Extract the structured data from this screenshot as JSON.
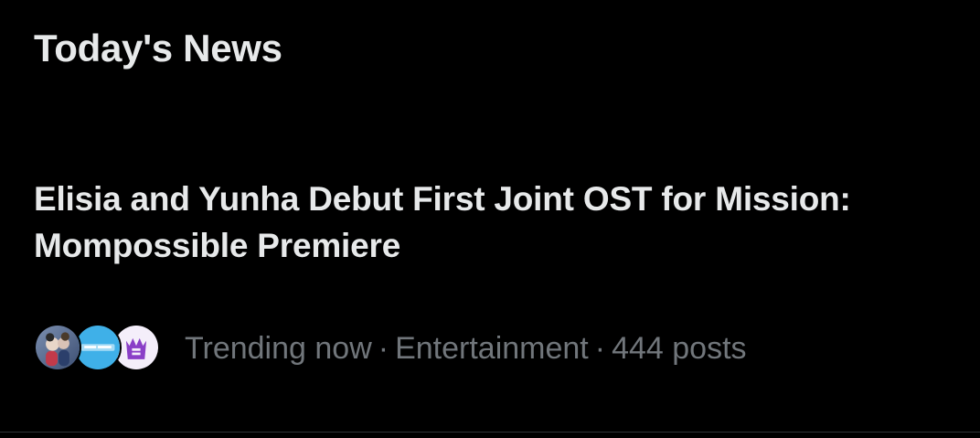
{
  "section": {
    "title": "Today's News"
  },
  "news_item": {
    "headline": "Elisia and Yunha Debut First Joint OST for Mission: Mompossible Premiere",
    "meta": {
      "status": "Trending now",
      "separator": "·",
      "category": "Entertainment",
      "posts": "444 posts"
    },
    "avatars": [
      {
        "name": "avatar-photo",
        "accent": "#5a8fd0"
      },
      {
        "name": "avatar-logo-blue",
        "accent": "#3fb0e8"
      },
      {
        "name": "avatar-crown-logo",
        "accent": "#8a3fc7"
      }
    ]
  },
  "colors": {
    "background": "#000000",
    "primary_text": "#e7e9ea",
    "secondary_text": "#71767b",
    "divider": "#2f3336"
  }
}
